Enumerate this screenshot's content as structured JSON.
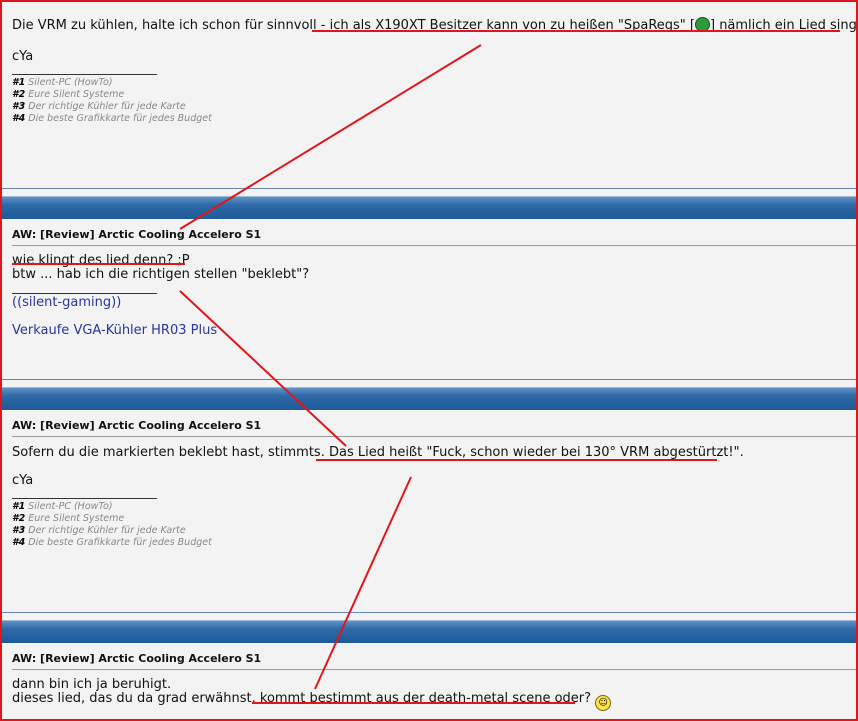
{
  "posts": [
    {
      "body_lines": [
        "Die VRM zu kühlen, halte ich schon für sinnvoll - ich als X190XT Besitzer kann von zu heißen \"SpaRegs\" [",
        "] nämlich ein Lied singen."
      ],
      "farewell": "cYa",
      "signature": [
        {
          "num": "#1",
          "text": "Silent-PC (HowTo)"
        },
        {
          "num": "#2",
          "text": "Eure Silent Systeme"
        },
        {
          "num": "#3",
          "text": "Der richtige Kühler für jede Karte"
        },
        {
          "num": "#4",
          "text": "Die beste Grafikkarte für jedes Budget"
        }
      ]
    },
    {
      "title": "AW: [Review] Arctic Cooling Accelero S1",
      "line1": "wie klingt des lied denn? ;P",
      "line2": "btw ... hab ich die richtigen stellen \"beklebt\"?",
      "link1": "((silent-gaming))",
      "link2": "Verkaufe VGA-Kühler HR03 Plus"
    },
    {
      "title": "AW: [Review] Arctic Cooling Accelero S1",
      "line1": "Sofern du die markierten beklebt hast, stimmts. Das Lied heißt \"Fuck, schon wieder bei 130° VRM abgestürtzt!\".",
      "farewell": "cYa",
      "signature": [
        {
          "num": "#1",
          "text": "Silent-PC (HowTo)"
        },
        {
          "num": "#2",
          "text": "Eure Silent Systeme"
        },
        {
          "num": "#3",
          "text": "Der richtige Kühler für jede Karte"
        },
        {
          "num": "#4",
          "text": "Die beste Grafikkarte für jedes Budget"
        }
      ]
    },
    {
      "title": "AW: [Review] Arctic Cooling Accelero S1",
      "line1": "dann bin ich ja beruhigt.",
      "line2": "dieses lied, das du da grad erwähnst, kommt bestimmt aus der death-metal scene oder?"
    }
  ],
  "colors": {
    "annotation": "#e0161a",
    "bar": "#2f6aa8",
    "link": "#27379b"
  }
}
